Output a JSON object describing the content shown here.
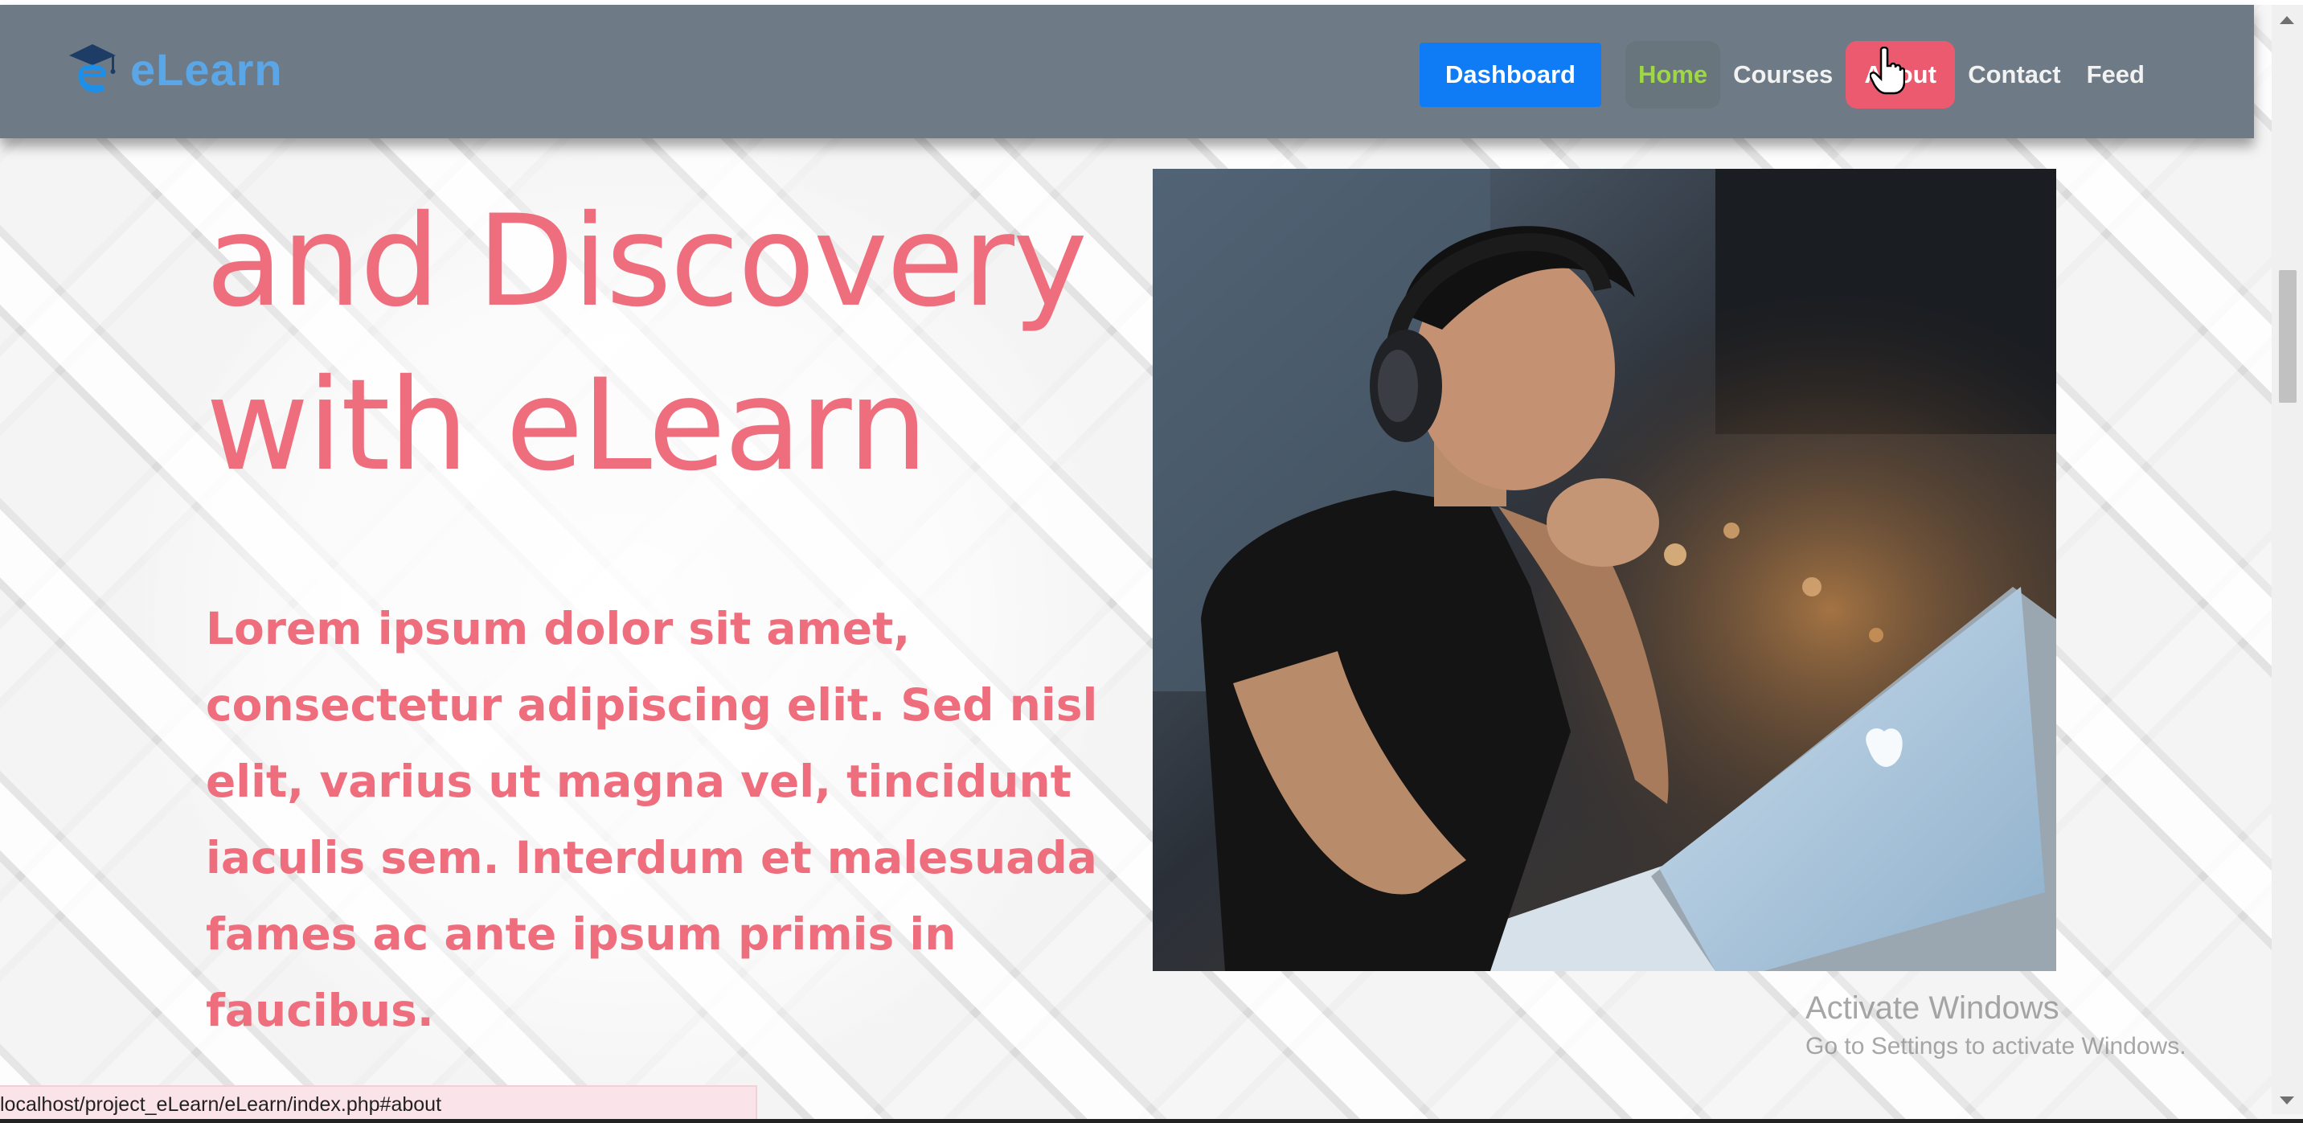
{
  "brand": {
    "name": "eLearn",
    "logo_icon": "graduation-cap-e-logo"
  },
  "nav": {
    "dashboard_label": "Dashboard",
    "items": [
      {
        "label": "Home",
        "state": "active"
      },
      {
        "label": "Courses",
        "state": "default"
      },
      {
        "label": "About",
        "state": "hover"
      },
      {
        "label": "Contact",
        "state": "default"
      },
      {
        "label": "Feed",
        "state": "default"
      }
    ]
  },
  "hero": {
    "title_line1": "and Discovery",
    "title_line2": "with eLearn",
    "paragraph": "Lorem ipsum dolor sit amet, consectetur adipiscing elit. Sed nisl elit, varius ut magna vel, tincidunt iaculis sem. Interdum et malesuada fames ac ante ipsum primis in faucibus.",
    "image_subject": "student-with-headphones-at-laptop"
  },
  "watermark": {
    "line1": "Activate Windows",
    "line2": "Go to Settings to activate Windows."
  },
  "status_bar": {
    "url": "localhost/project_eLearn/eLearn/index.php#about"
  },
  "colors": {
    "navbar_bg": "#6e7b86",
    "brand": "#5aa6e6",
    "dashboard_button": "#0f7cf5",
    "active_link": "#9ed843",
    "hover_link_bg": "#ec5a70",
    "hero_text": "#ee6e7d"
  }
}
